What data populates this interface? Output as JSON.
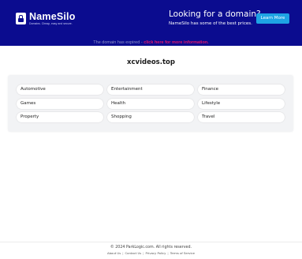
{
  "header": {
    "brand_name": "NameSilo",
    "brand_tagline": "Domains. Cheap, easy and secure.",
    "promo_title": "Looking for a domain?",
    "promo_subtitle": "NameSilo has some of the best prices.",
    "learn_more_label": "Learn More",
    "colors": {
      "background": "#0b0c8f",
      "button": "#1ea3e4"
    }
  },
  "notice": {
    "text": "The domain has expired - ",
    "link_text": "click here for more information."
  },
  "domain": "xcvideos.top",
  "categories": [
    "Automotive",
    "Entertainment",
    "Finance",
    "Games",
    "Health",
    "Lifestyle",
    "Property",
    "Shopping",
    "Travel"
  ],
  "footer": {
    "copyright": "© 2024 ParkLogic.com. All rights reserved.",
    "links": [
      "About Us",
      "Contact Us",
      "Privacy Policy",
      "Terms of Service"
    ]
  }
}
